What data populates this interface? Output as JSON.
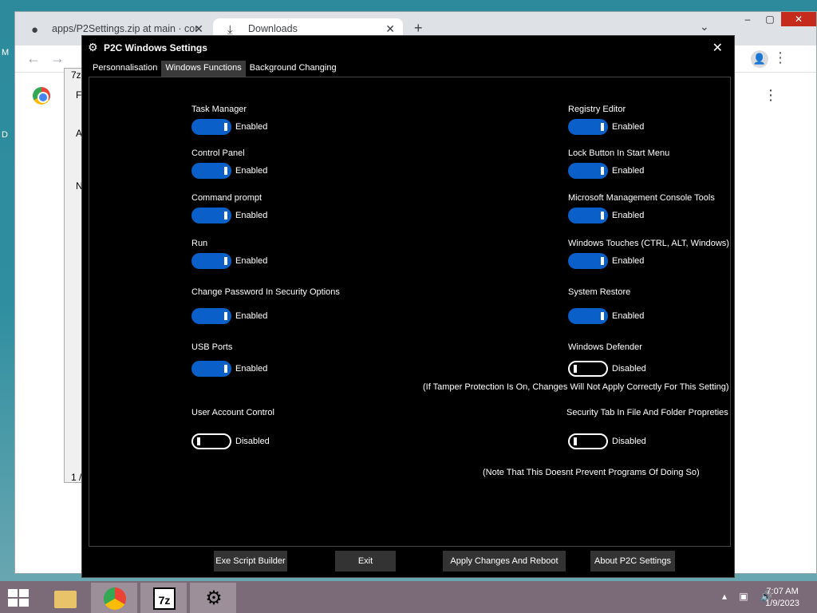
{
  "desktop": {
    "letters": [
      "M",
      "D"
    ]
  },
  "browser": {
    "tabs": [
      {
        "title": "apps/P2Settings.zip at main · cor",
        "icon": "github-icon"
      },
      {
        "title": "Downloads",
        "icon": "download-icon"
      }
    ],
    "new_tab": "+",
    "toolbar": {
      "back": "←",
      "forward": "→"
    }
  },
  "sevenzip": {
    "items": [
      "7z",
      "Fi",
      "A",
      "N",
      "1 /"
    ]
  },
  "app": {
    "title": "P2C Windows Settings",
    "tabs": [
      {
        "label": "Personnalisation",
        "active": false
      },
      {
        "label": "Windows Functions",
        "active": true
      },
      {
        "label": "Background Changing",
        "active": false
      }
    ],
    "left_settings": [
      {
        "label": "Task Manager",
        "state": "Enabled",
        "on": true
      },
      {
        "label": "Control Panel",
        "state": "Enabled",
        "on": true
      },
      {
        "label": "Command prompt",
        "state": "Enabled",
        "on": true
      },
      {
        "label": "Run",
        "state": "Enabled",
        "on": true
      },
      {
        "label": "Change Password In Security Options",
        "state": "Enabled",
        "on": true
      },
      {
        "label": "USB Ports",
        "state": "Enabled",
        "on": true
      },
      {
        "label": "User Account Control",
        "state": "Disabled",
        "on": false
      }
    ],
    "right_settings": [
      {
        "label": "Registry Editor",
        "state": "Enabled",
        "on": true
      },
      {
        "label": "Lock Button In Start Menu",
        "state": "Enabled",
        "on": true
      },
      {
        "label": "Microsoft Management Console Tools",
        "state": "Enabled",
        "on": true
      },
      {
        "label": "Windows Touches (CTRL, ALT, Windows)",
        "state": "Enabled",
        "on": true
      },
      {
        "label": "System Restore",
        "state": "Enabled",
        "on": true
      },
      {
        "label": "Windows Defender",
        "state": "Disabled",
        "on": false
      },
      {
        "label": "Security Tab In File And Folder Propreties",
        "state": "Disabled",
        "on": false
      }
    ],
    "notes": {
      "defender": "(If Tamper Protection Is On, Changes Will Not Apply Correctly For This Setting)",
      "security_tab": "(Note That This Doesnt Prevent Programs Of Doing So)"
    },
    "buttons": {
      "script_builder": "Exe Script Builder",
      "exit": "Exit",
      "apply": "Apply Changes And Reboot",
      "about": "About P2C Settings"
    }
  },
  "taskbar": {
    "apps": [
      {
        "name": "file-explorer-icon"
      },
      {
        "name": "chrome-icon"
      },
      {
        "name": "7zip-icon",
        "label": "7z"
      },
      {
        "name": "settings-gear-icon"
      }
    ],
    "time": "7:07 AM",
    "date": "1/9/2023"
  }
}
